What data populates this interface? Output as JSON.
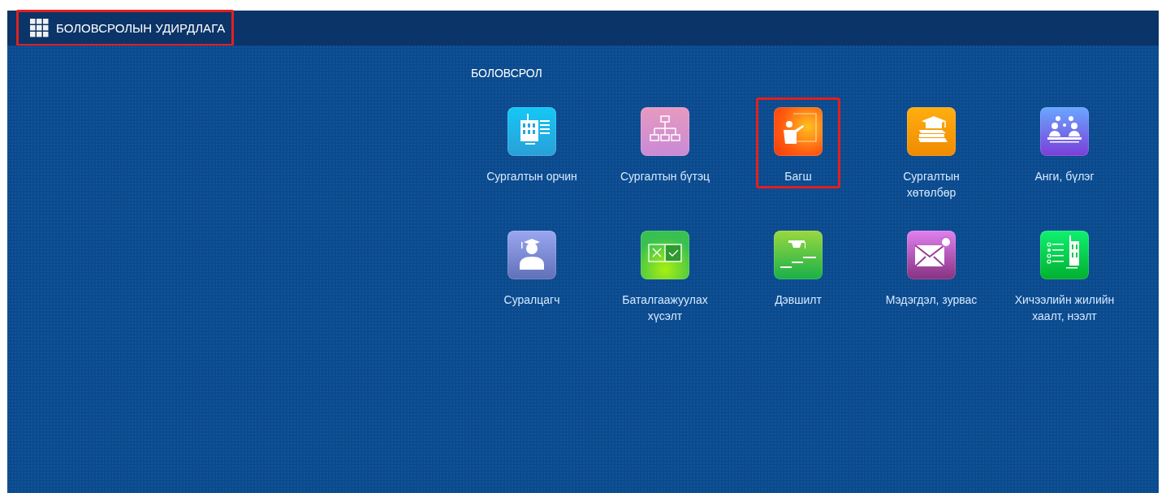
{
  "header": {
    "title": "БОЛОВСРОЛЫН УДИРДЛАГА",
    "highlighted": true
  },
  "section": {
    "title": "БОЛОВСРОЛ",
    "tiles": [
      {
        "kind": "building",
        "label": "Сургалтын орчин",
        "highlighted": false
      },
      {
        "kind": "hierarchy",
        "label": "Сургалтын бүтэц",
        "highlighted": false
      },
      {
        "kind": "teacher",
        "label": "Багш",
        "highlighted": true
      },
      {
        "kind": "books",
        "label": "Сургалтын хөтөлбөр",
        "highlighted": false
      },
      {
        "kind": "group",
        "label": "Анги, бүлэг",
        "highlighted": false
      },
      {
        "kind": "student",
        "label": "Суралцагч",
        "highlighted": false
      },
      {
        "kind": "checklist",
        "label": "Баталгаажуулах хүсэлт",
        "highlighted": false
      },
      {
        "kind": "steps",
        "label": "Дэвшилт",
        "highlighted": false
      },
      {
        "kind": "mail",
        "label": "Мэдэгдэл, зурвас",
        "highlighted": false
      },
      {
        "kind": "schedule",
        "label": "Хичээлийн жилийн хаалт, нээлт",
        "highlighted": false
      }
    ]
  }
}
